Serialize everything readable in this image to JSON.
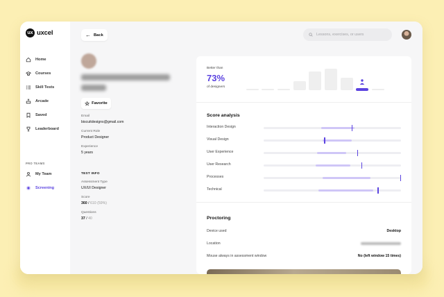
{
  "brand": {
    "name": "uxcel",
    "mark": "ux"
  },
  "sidebar": {
    "items": [
      {
        "label": "Home",
        "icon": "home-icon"
      },
      {
        "label": "Courses",
        "icon": "courses-icon"
      },
      {
        "label": "Skill Tests",
        "icon": "skill-tests-icon"
      },
      {
        "label": "Arcade",
        "icon": "arcade-icon"
      },
      {
        "label": "Saved",
        "icon": "bookmark-icon"
      },
      {
        "label": "Leaderboard",
        "icon": "trophy-icon"
      }
    ],
    "section_label": "PRO TEAMS",
    "team_items": [
      {
        "label": "My Team",
        "icon": "team-icon"
      },
      {
        "label": "Screening",
        "icon": "screening-icon",
        "active": true
      }
    ]
  },
  "header": {
    "back_label": "Back",
    "search_placeholder": "Lessons, exercises, or users"
  },
  "profile": {
    "favorite_label": "Favorite",
    "email_label": "Email",
    "email": "biscuitdesigns@gmail.com",
    "role_label": "Current Role",
    "role": "Product Designer",
    "experience_label": "Experience",
    "experience": "5 years",
    "test_info_title": "TEST INFO",
    "assessment_label": "Assessment Type",
    "assessment": "UX/UI Designer",
    "score_label": "Score",
    "score": "360",
    "score_sep": "/",
    "score_total": "610 (59%)",
    "questions_label": "Questions",
    "questions": "37",
    "questions_sep": "/",
    "questions_total": "40"
  },
  "summary": {
    "better_than": "Better than",
    "percent": "73%",
    "of_designers": "of designers",
    "accent": "#5b43e0"
  },
  "score_analysis": {
    "title": "Score analysis",
    "rows": [
      {
        "label": "Interaction Design",
        "range": [
          0.42,
          0.66
        ],
        "marker": 0.64
      },
      {
        "label": "Visual Design",
        "range": [
          0.43,
          0.64
        ],
        "marker": 0.44
      },
      {
        "label": "User Experience",
        "range": [
          0.39,
          0.6
        ],
        "marker": 0.68
      },
      {
        "label": "User Research",
        "range": [
          0.38,
          0.63
        ],
        "marker": 0.71
      },
      {
        "label": "Processes",
        "range": [
          0.43,
          0.78
        ],
        "marker": 1.0
      },
      {
        "label": "Technical",
        "range": [
          0.4,
          0.8
        ],
        "marker": 0.83
      }
    ]
  },
  "proctoring": {
    "title": "Proctoring",
    "rows": [
      {
        "label": "Device used",
        "value": "Desktop"
      },
      {
        "label": "Location",
        "value": ""
      },
      {
        "label": "Mouse always in assessment window",
        "value": "No (left window 15 times)"
      }
    ]
  }
}
